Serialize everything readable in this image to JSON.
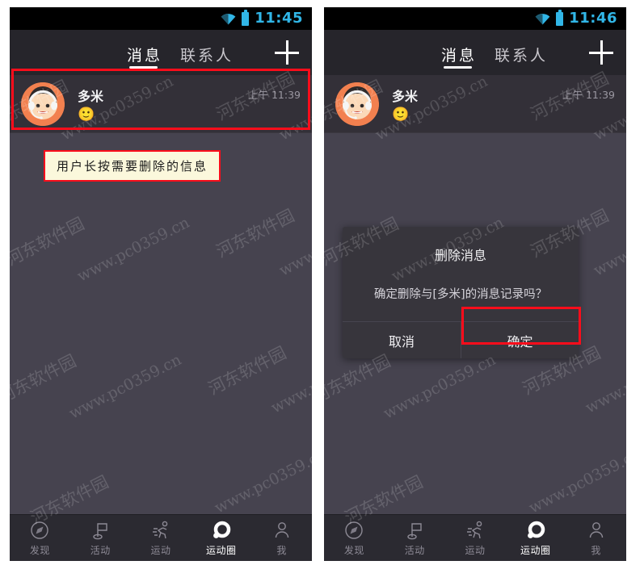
{
  "meta": {
    "accent_red": "#fc0d1b",
    "callout_bg": "#fbf8dc",
    "status_blue": "#31b6e7",
    "avatar_orange": "#f2804f",
    "body_bg": "#46434f",
    "header_bg": "#26252b",
    "row_bg": "#333038",
    "dialog_bg": "#37353c"
  },
  "watermark": {
    "cn": "河东软件园",
    "url": "www.pc0359.cn"
  },
  "left_phone": {
    "status": {
      "time": "11:45",
      "wifi_icon": "wifi-icon",
      "battery_icon": "battery-icon"
    },
    "header": {
      "tabs": [
        {
          "label": "消息",
          "active": true
        },
        {
          "label": "联系人",
          "active": false
        }
      ],
      "add_icon": "plus-icon"
    },
    "message": {
      "name": "多米",
      "preview_emoji": "🙂",
      "time": "上午 11:39",
      "avatar_icon": "avatar-girl-headset-icon"
    },
    "callout": {
      "text": "用户长按需要删除的信息"
    },
    "bottom_nav": [
      {
        "label": "发现",
        "icon": "compass-icon",
        "active": false
      },
      {
        "label": "活动",
        "icon": "flag-icon",
        "active": false
      },
      {
        "label": "运动",
        "icon": "runner-icon",
        "active": false
      },
      {
        "label": "运动圈",
        "icon": "circle-dot-icon",
        "active": true
      },
      {
        "label": "我",
        "icon": "person-icon",
        "active": false
      }
    ]
  },
  "right_phone": {
    "status": {
      "time": "11:46",
      "wifi_icon": "wifi-icon",
      "battery_icon": "battery-icon"
    },
    "header": {
      "tabs": [
        {
          "label": "消息",
          "active": true
        },
        {
          "label": "联系人",
          "active": false
        }
      ],
      "add_icon": "plus-icon"
    },
    "message": {
      "name": "多米",
      "preview_emoji": "🙂",
      "time": "上午 11:39",
      "avatar_icon": "avatar-girl-headset-icon"
    },
    "dialog": {
      "title": "删除消息",
      "message": "确定删除与[多米]的消息记录吗？",
      "cancel_label": "取消",
      "confirm_label": "确定"
    },
    "bottom_nav": [
      {
        "label": "发现",
        "icon": "compass-icon",
        "active": false
      },
      {
        "label": "活动",
        "icon": "flag-icon",
        "active": false
      },
      {
        "label": "运动",
        "icon": "runner-icon",
        "active": false
      },
      {
        "label": "运动圈",
        "icon": "circle-dot-icon",
        "active": true
      },
      {
        "label": "我",
        "icon": "person-icon",
        "active": false
      }
    ]
  }
}
